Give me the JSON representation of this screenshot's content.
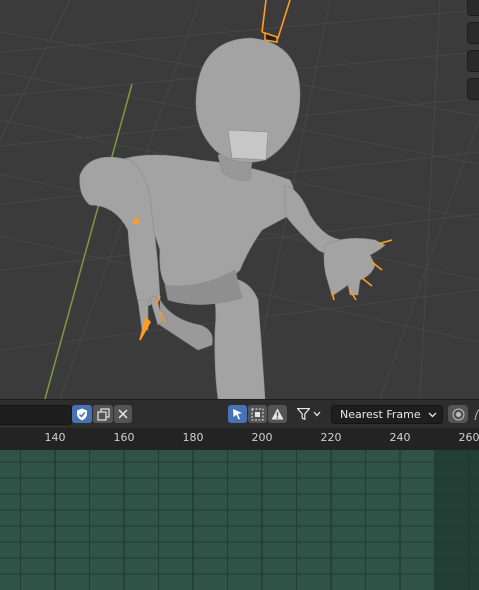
{
  "viewport": {
    "name": "3D Viewport",
    "colors": {
      "background": "#3b3b3b",
      "mesh": "#a3a3a3",
      "bone_highlight": "#ff9c21",
      "y_axis": "#7f9a3f"
    }
  },
  "header": {
    "search_value": "",
    "snap_mode": "Nearest Frame",
    "icons": [
      "shield-check-icon",
      "copy-icon",
      "close-icon",
      "select-arrow-icon",
      "box-select-icon",
      "warning-icon",
      "filter-icon",
      "chevron-down-icon",
      "proportional-edit-icon"
    ]
  },
  "ruler": {
    "labels": [
      "140",
      "160",
      "180",
      "200",
      "220",
      "240",
      "260"
    ],
    "frame_start": 140,
    "frame_step": 20
  },
  "channels": {
    "colors": {
      "background": "#2f5447",
      "row_line": "#213b32",
      "column_line": "#1f3831"
    },
    "out_of_range_from_frame": 250
  }
}
